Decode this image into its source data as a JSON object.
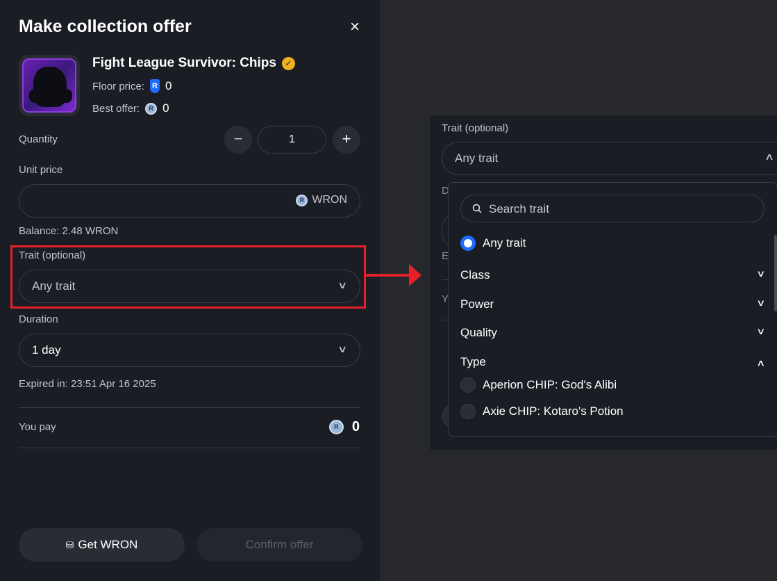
{
  "modal": {
    "title": "Make collection offer",
    "close_icon": "×"
  },
  "collection": {
    "name": "Fight League Survivor: Chips",
    "verified_mark": "✓",
    "floor_price_label": "Floor price:",
    "floor_price_value": "0",
    "best_offer_label": "Best offer:",
    "best_offer_value": "0"
  },
  "quantity": {
    "label": "Quantity",
    "value": "1",
    "decrement": "−",
    "increment": "+"
  },
  "unit_price": {
    "label": "Unit price",
    "value": "",
    "currency": "WRON",
    "balance": "Balance: 2.48 WRON"
  },
  "trait": {
    "label": "Trait (optional)",
    "selected": "Any trait"
  },
  "duration": {
    "label": "Duration",
    "selected": "1 day",
    "expires": "Expired in: 23:51 Apr 16 2025"
  },
  "pay": {
    "label": "You pay",
    "value": "0"
  },
  "buttons": {
    "get_wron": "Get WRON",
    "confirm": "Confirm offer"
  },
  "dropdown": {
    "field_label": "Trait (optional)",
    "selected": "Any trait",
    "search_placeholder": "Search trait",
    "any_option": "Any trait",
    "groups": [
      {
        "label": "Class",
        "expanded": false
      },
      {
        "label": "Power",
        "expanded": false
      },
      {
        "label": "Quality",
        "expanded": false
      },
      {
        "label": "Type",
        "expanded": true
      }
    ],
    "type_options": [
      "Aperion CHIP: God's Alibi",
      "Axie CHIP: Kotaro's Potion"
    ],
    "bg_letters": [
      "D",
      "E",
      "Y"
    ]
  },
  "colors": {
    "accent_blue": "#1f6bff",
    "highlight_red": "#e8202a",
    "verified_gold": "#f2b01e",
    "panel_bg": "#1b1d24"
  },
  "icons": [
    "close-icon",
    "verified-icon",
    "ron-shield-icon",
    "ron-coin-icon",
    "minus-icon",
    "plus-icon",
    "chevron-down-icon",
    "chevron-up-icon",
    "search-icon",
    "wallet-icon"
  ]
}
